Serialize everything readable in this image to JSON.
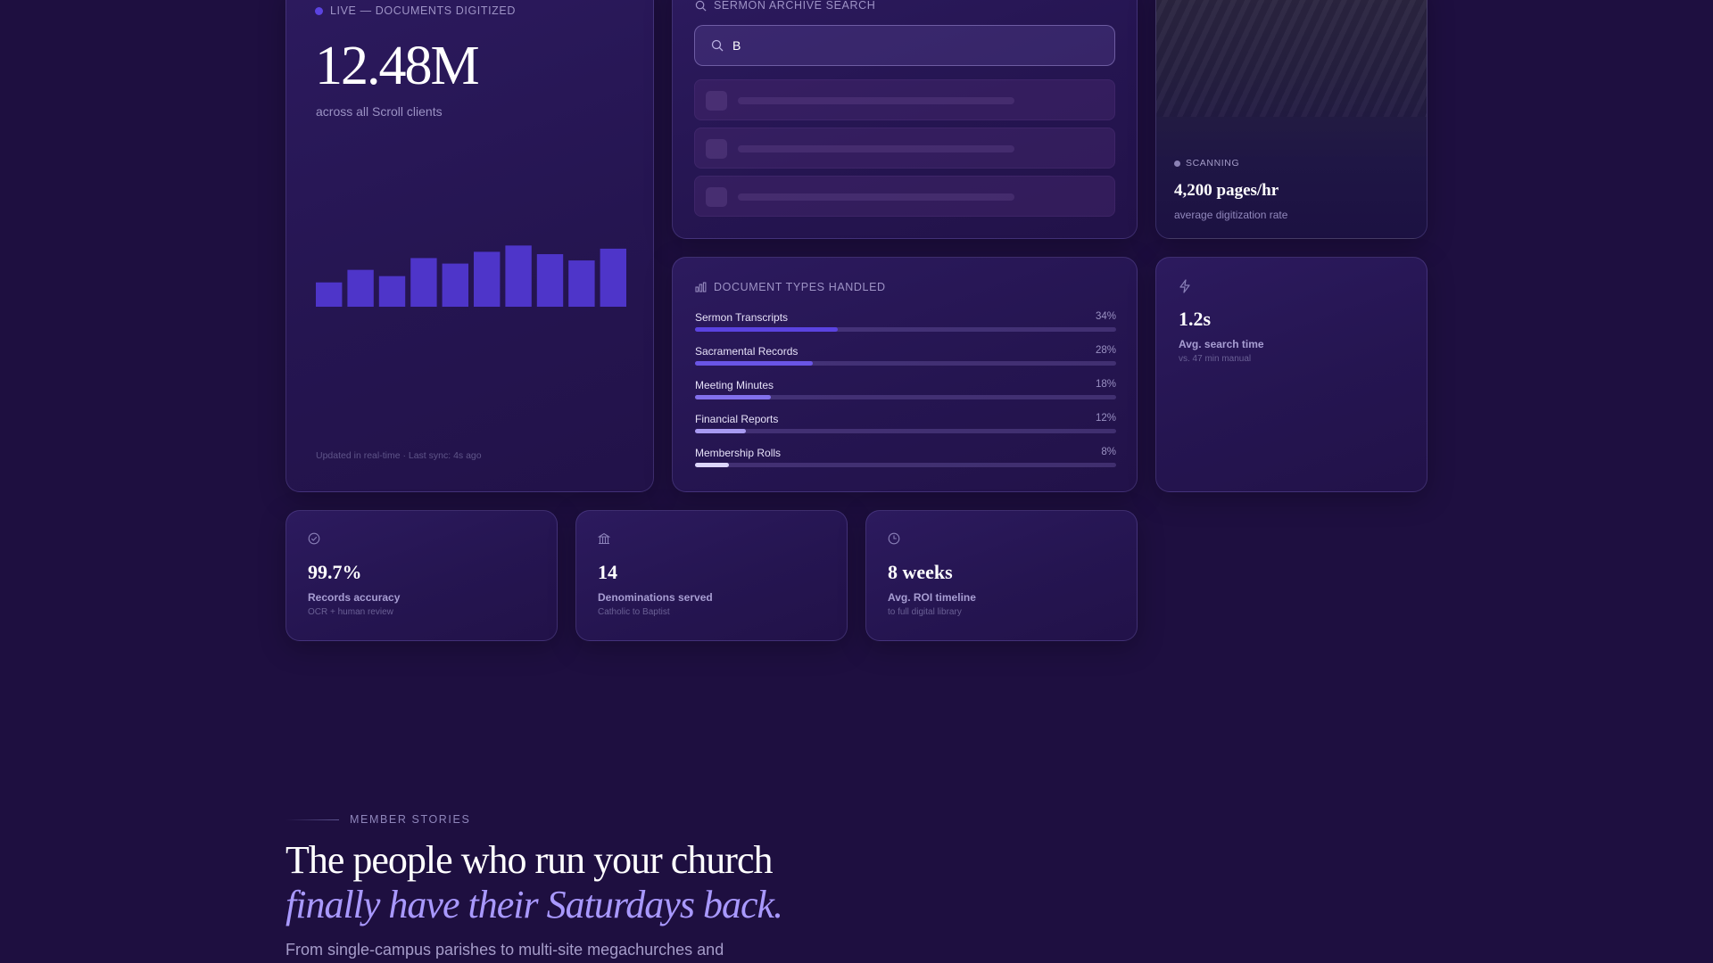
{
  "live_card": {
    "eyebrow": "LIVE — DOCUMENTS DIGITIZED",
    "value": "12.48M",
    "caption": "across all Scroll clients",
    "footer": "Updated in real-time · Last sync: 4s ago",
    "bar_color": "#4e35c9",
    "chart_data": {
      "type": "bar",
      "values": [
        31,
        47,
        39,
        62,
        55,
        70,
        78,
        67,
        59,
        74
      ],
      "ylim": [
        0,
        100
      ]
    }
  },
  "search_card": {
    "eyebrow": "SERMON ARCHIVE SEARCH",
    "search_value": "B",
    "search_icon": "search-icon",
    "skeleton_rows": 3
  },
  "scan_card": {
    "eyebrow": "SCANNING",
    "value": "4,200 pages/hr",
    "caption": "average digitization rate"
  },
  "types_card": {
    "eyebrow": "DOCUMENT TYPES HANDLED",
    "icon": "bar-chart-icon",
    "items": [
      {
        "label": "Sermon Transcripts",
        "pct": "34%",
        "value": 34,
        "color": "#5b43e0"
      },
      {
        "label": "Sacramental Records",
        "pct": "28%",
        "value": 28,
        "color": "#6a55e6"
      },
      {
        "label": "Meeting Minutes",
        "pct": "18%",
        "value": 18,
        "color": "#8270ec"
      },
      {
        "label": "Financial Reports",
        "pct": "12%",
        "value": 12,
        "color": "#a89af2"
      },
      {
        "label": "Membership Rolls",
        "pct": "8%",
        "value": 8,
        "color": "#dcd6fb"
      }
    ]
  },
  "search_time": {
    "icon": "lightning-icon",
    "value": "1.2s",
    "label": "Avg. search time",
    "sub": "vs. 47 min manual"
  },
  "stats": [
    {
      "icon": "check-circle-icon",
      "value": "99.7%",
      "label": "Records accuracy",
      "sub": "OCR + human review"
    },
    {
      "icon": "church-icon",
      "value": "14",
      "label": "Denominations served",
      "sub": "Catholic to Baptist"
    },
    {
      "icon": "clock-icon",
      "value": "8 weeks",
      "label": "Avg. ROI timeline",
      "sub": "to full digital library"
    }
  ],
  "member": {
    "eyebrow": "MEMBER STORIES",
    "headline": "The people who run your church",
    "headline_em": "finally have their Saturdays back.",
    "paragraph": "From single-campus parishes to multi-site megachurches and"
  }
}
